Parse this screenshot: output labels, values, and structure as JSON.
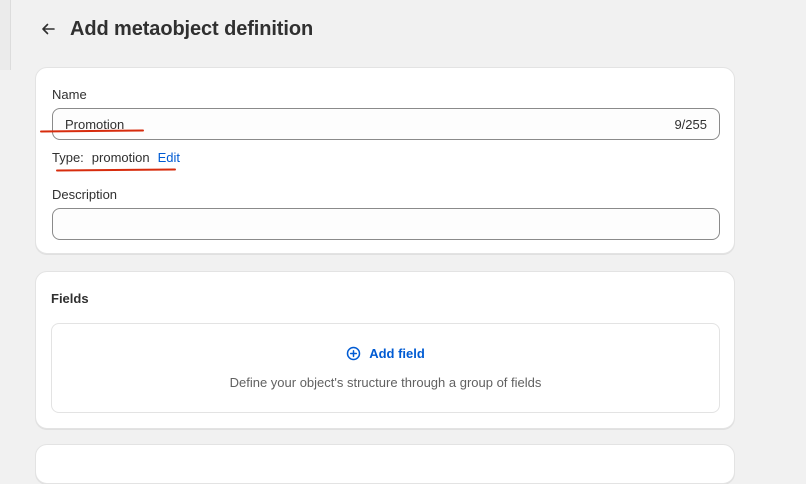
{
  "page": {
    "title": "Add metaobject definition",
    "back_icon": "arrow-left-icon"
  },
  "definition": {
    "name_label": "Name",
    "name_value": "Promotion",
    "name_counter": "9/255",
    "type_label": "Type:",
    "type_value": "promotion",
    "edit_label": "Edit",
    "description_label": "Description",
    "description_value": ""
  },
  "fields": {
    "title": "Fields",
    "add_field_label": "Add field",
    "add_icon": "plus-circle-icon",
    "empty_description": "Define your object's structure through a group of fields"
  },
  "colors": {
    "accent": "#005bd3",
    "annotation": "#d72c0d",
    "background": "#f1f1f1"
  }
}
